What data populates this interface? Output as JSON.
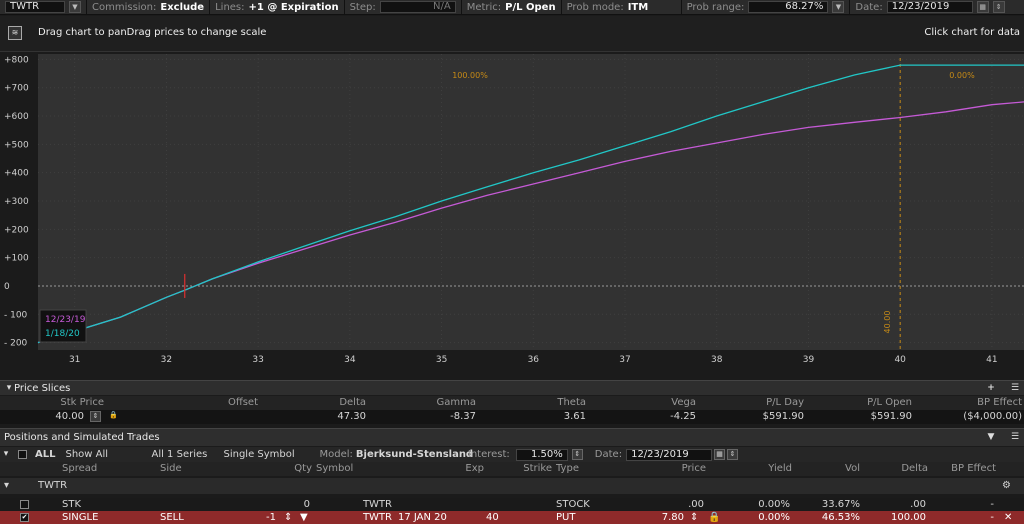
{
  "toolbar": {
    "symbol": "TWTR",
    "commission_label": "Commission:",
    "commission_value": "Exclude",
    "lines_label": "Lines:",
    "lines_value": "+1 @ Expiration",
    "step_label": "Step:",
    "step_value": "N/A",
    "metric_label": "Metric:",
    "metric_value": "P/L Open",
    "prob_mode_label": "Prob mode:",
    "prob_mode_value": "ITM",
    "prob_range_label": "Prob range:",
    "prob_range_value": "68.27%",
    "date_label": "Date:",
    "date_value": "12/23/2019"
  },
  "chart_header": {
    "hint": "Drag chart to panDrag prices to change scale",
    "right_text": "Click chart for data"
  },
  "chart_data": {
    "type": "line",
    "x_ticks": [
      "31",
      "32",
      "33",
      "34",
      "35",
      "36",
      "37",
      "38",
      "39",
      "40",
      "41"
    ],
    "y_ticks": [
      "+800",
      "+700",
      "+600",
      "+500",
      "+400",
      "+300",
      "+200",
      "+100",
      "0",
      "- 100",
      "- 200"
    ],
    "xlim": [
      30.6,
      41.35
    ],
    "ylim": [
      -205,
      805
    ],
    "prob_left": "100.00%",
    "prob_right": "0.00%",
    "marker_label": "40.00",
    "marker_x": 40,
    "legend": [
      "12/23/19",
      "1/18/20"
    ],
    "series": [
      {
        "name": "12/23/19",
        "color": "#c55ad6",
        "x": [
          30.6,
          31,
          31.5,
          32,
          32.2,
          32.5,
          33,
          33.5,
          34,
          34.5,
          35,
          35.5,
          36,
          36.5,
          37,
          37.5,
          38,
          38.5,
          39,
          39.5,
          40,
          40.5,
          41,
          41.35
        ],
        "y": [
          -200,
          -160,
          -110,
          -40,
          -15,
          25,
          80,
          130,
          180,
          225,
          275,
          320,
          360,
          400,
          440,
          475,
          505,
          535,
          560,
          578,
          595,
          615,
          640,
          650
        ]
      },
      {
        "name": "1/18/20",
        "color": "#21c7c7",
        "x": [
          30.6,
          31,
          31.5,
          32,
          32.2,
          32.5,
          33,
          33.5,
          34,
          34.5,
          35,
          35.5,
          36,
          36.5,
          37,
          37.5,
          38,
          38.5,
          39,
          39.5,
          40,
          40.5,
          41,
          41.35
        ],
        "y": [
          -200,
          -160,
          -110,
          -40,
          -15,
          25,
          85,
          140,
          195,
          245,
          300,
          350,
          400,
          445,
          495,
          545,
          600,
          650,
          700,
          745,
          780,
          780,
          780,
          780
        ]
      }
    ]
  },
  "price_slices": {
    "title": "Price Slices",
    "add_icon": "+",
    "headers": {
      "stk_price": "Stk Price",
      "offset": "Offset",
      "delta": "Delta",
      "gamma": "Gamma",
      "theta": "Theta",
      "vega": "Vega",
      "pl_day": "P/L Day",
      "pl_open": "P/L Open",
      "bp_effect": "BP Effect"
    },
    "values": {
      "stk_price": "40.00",
      "offset": "",
      "delta": "47.30",
      "gamma": "-8.37",
      "theta": "3.61",
      "vega": "-4.25",
      "pl_day": "$591.90",
      "pl_open": "$591.90",
      "bp_effect": "($4,000.00)"
    }
  },
  "positions": {
    "title": "Positions and Simulated Trades",
    "all_label": "ALL",
    "show_all": "Show All",
    "series": "All 1 Series",
    "symbol_mode": "Single Symbol",
    "model_label": "Model:",
    "model_value": "Bjerksund-Stensland",
    "interest_label": "Interest:",
    "interest_value": "1.50%",
    "date_label": "Date:",
    "date_value": "12/23/2019",
    "columns": {
      "spread": "Spread",
      "side": "Side",
      "qty": "Qty",
      "symbol": "Symbol",
      "exp": "Exp",
      "strike": "Strike",
      "type": "Type",
      "price": "Price",
      "yield": "Yield",
      "vol": "Vol",
      "delta": "Delta",
      "bp_effect": "BP Effect"
    },
    "group": "TWTR",
    "rows": [
      {
        "spread": "STK",
        "side": "",
        "qty": "0",
        "symbol": "TWTR",
        "exp": "",
        "strike": "",
        "type": "STOCK",
        "price": ".00",
        "yield": "0.00%",
        "vol": "33.67%",
        "delta": ".00",
        "bp_effect": "-"
      },
      {
        "spread": "SINGLE",
        "side": "SELL",
        "qty": "-1",
        "symbol": "TWTR",
        "exp": "17 JAN 20",
        "strike": "40",
        "type": "PUT",
        "price": "7.80",
        "yield": "0.00%",
        "vol": "46.53%",
        "delta": "100.00",
        "bp_effect": "-"
      }
    ]
  }
}
